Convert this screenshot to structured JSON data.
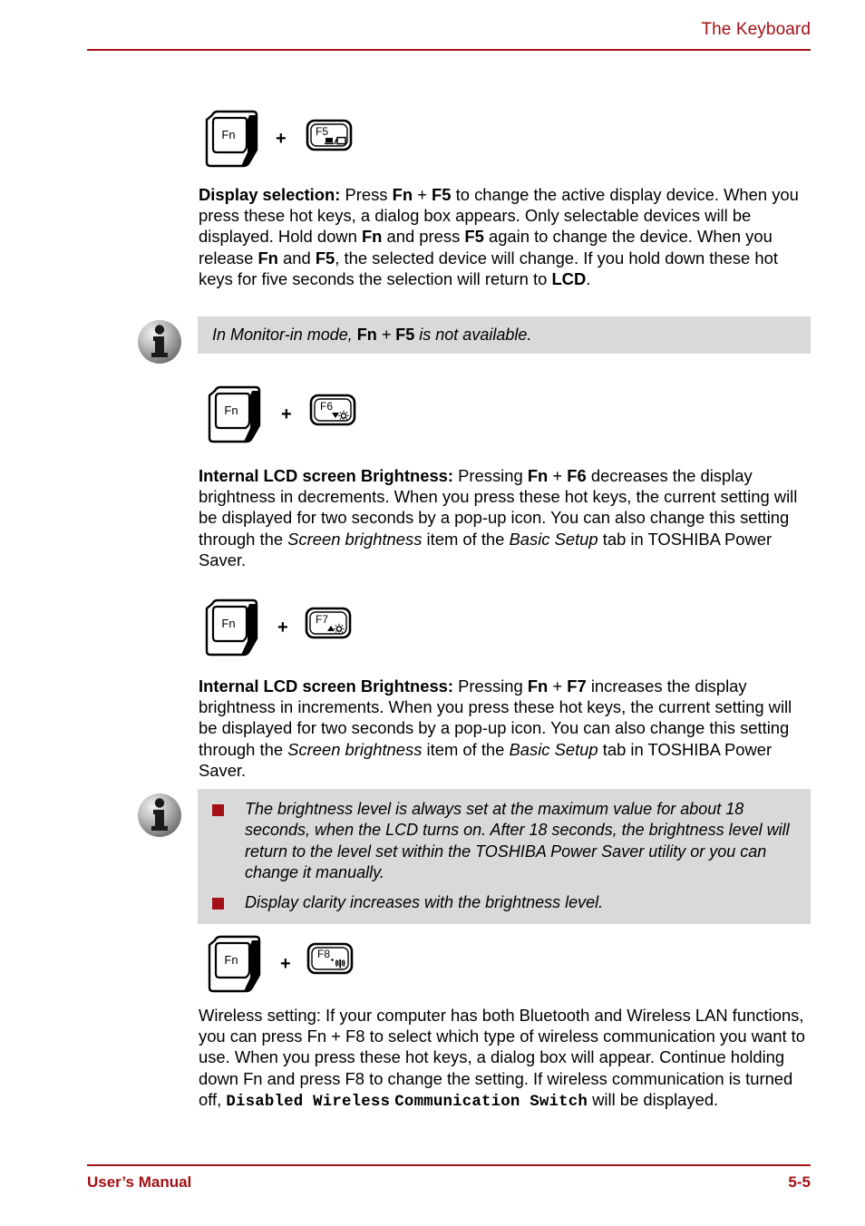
{
  "header": {
    "title": "The Keyboard"
  },
  "footer": {
    "left": "User’s Manual",
    "right": "5-5"
  },
  "symbols": {
    "plus": "+",
    "fn_label": "Fn"
  },
  "sections": [
    {
      "key_combo": {
        "modifier": "Fn",
        "function_key": "F5",
        "function_key_icon": "display-selection-icon"
      },
      "paragraph": {
        "lead": "Display selection:",
        "text": " Press Fn + F5 to change the active display device. When you press these hot keys, a dialog box appears. Only selectable devices will be displayed. Hold down Fn and press F5 again to change the device. When you release Fn and F5, the selected device will change. If you hold down these hot keys for five seconds the selection will return to LCD."
      },
      "note": {
        "icon": "info-icon",
        "text": "In Monitor-in mode, Fn + F5 is not available."
      }
    },
    {
      "key_combo": {
        "modifier": "Fn",
        "function_key": "F6",
        "function_key_icon": "brightness-down-icon"
      },
      "paragraph": {
        "lead": "Internal LCD screen Brightness:",
        "text": " Pressing Fn + F6 decreases the display brightness in decrements. When you press these hot keys, the current setting will be displayed for two seconds by a pop-up icon. You can also change this setting through the Screen brightness item of the Basic Setup tab in TOSHIBA Power Saver."
      }
    },
    {
      "key_combo": {
        "modifier": "Fn",
        "function_key": "F7",
        "function_key_icon": "brightness-up-icon"
      },
      "paragraph": {
        "lead": "Internal LCD screen Brightness:",
        "text": " Pressing Fn + F7 increases the display brightness in increments. When you press these hot keys, the current setting will be displayed for two seconds by a pop-up icon. You can also change this setting through the Screen brightness item of the Basic Setup tab in TOSHIBA Power Saver."
      },
      "note": {
        "icon": "info-icon",
        "bullets": [
          "The brightness level is always set at the maximum value for about 18 seconds, when the LCD turns on. After 18 seconds, the brightness level will return to the level set within the TOSHIBA Power Saver utility or you can change it manually.",
          "Display clarity increases with the brightness level."
        ]
      }
    },
    {
      "key_combo": {
        "modifier": "Fn",
        "function_key": "F8",
        "function_key_icon": "wireless-icon"
      },
      "paragraph": {
        "text_part1": "Wireless setting: If your computer has both Bluetooth and Wireless LAN functions, you can press Fn + F8 to select which type of wireless communication you want to use. When you press these hot keys, a dialog box will appear. Continue holding down Fn and press F8 to change the setting. If wireless communication is turned off, ",
        "code": "Disabled Wireless Communication Switch",
        "text_part2": " will be displayed."
      }
    }
  ],
  "text_runs": {
    "p1": [
      {
        "t": "Display selection:",
        "s": "b"
      },
      {
        "t": " Press ",
        "s": ""
      },
      {
        "t": "Fn",
        "s": "b"
      },
      {
        "t": " + ",
        "s": ""
      },
      {
        "t": "F5",
        "s": "b"
      },
      {
        "t": " to change the active display device. When you press these hot keys, a dialog box appears. Only selectable devices will be displayed. Hold down ",
        "s": ""
      },
      {
        "t": "Fn",
        "s": "b"
      },
      {
        "t": " and press ",
        "s": ""
      },
      {
        "t": "F5",
        "s": "b"
      },
      {
        "t": " again to change the device. When you release ",
        "s": ""
      },
      {
        "t": "Fn",
        "s": "b"
      },
      {
        "t": " and ",
        "s": ""
      },
      {
        "t": "F5",
        "s": "b"
      },
      {
        "t": ", the selected device will change. If you hold down these hot keys for five seconds the selection will return to ",
        "s": ""
      },
      {
        "t": "LCD",
        "s": "b"
      },
      {
        "t": ".",
        "s": ""
      }
    ],
    "note1": [
      {
        "t": "In Monitor-in mode, ",
        "s": "i"
      },
      {
        "t": "Fn",
        "s": "b"
      },
      {
        "t": " + ",
        "s": "i"
      },
      {
        "t": "F5",
        "s": "b"
      },
      {
        "t": " is not available.",
        "s": "i"
      }
    ],
    "p2": [
      {
        "t": "Internal LCD screen Brightness:",
        "s": "b"
      },
      {
        "t": " Pressing ",
        "s": ""
      },
      {
        "t": "Fn",
        "s": "b"
      },
      {
        "t": " + ",
        "s": ""
      },
      {
        "t": "F6",
        "s": "b"
      },
      {
        "t": " decreases the display brightness in decrements. When you press these hot keys, the current setting will be displayed for two seconds by a pop-up icon. You can also change this setting through the ",
        "s": ""
      },
      {
        "t": "Screen brightness",
        "s": "i"
      },
      {
        "t": " item of the ",
        "s": ""
      },
      {
        "t": "Basic Setup",
        "s": "i"
      },
      {
        "t": " tab in TOSHIBA Power Saver.",
        "s": ""
      }
    ],
    "p3": [
      {
        "t": "Internal LCD screen Brightness:",
        "s": "b"
      },
      {
        "t": " Pressing ",
        "s": ""
      },
      {
        "t": "Fn",
        "s": "b"
      },
      {
        "t": " + ",
        "s": ""
      },
      {
        "t": "F7",
        "s": "b"
      },
      {
        "t": " increases the display brightness in increments. When you press these hot keys, the current setting will be displayed for two seconds by a pop-up icon. You can also change this setting through the ",
        "s": ""
      },
      {
        "t": "Screen brightness",
        "s": "i"
      },
      {
        "t": " item of the ",
        "s": ""
      },
      {
        "t": "Basic Setup",
        "s": "i"
      },
      {
        "t": " tab in TOSHIBA Power Saver.",
        "s": ""
      }
    ],
    "note2a": [
      {
        "t": "The brightness level is always set at the maximum value for about 18 seconds, when the LCD turns on. After 18 seconds, the brightness level will return to the level set within the TOSHIBA Power Saver utility or you can change it manually.",
        "s": "i"
      }
    ],
    "note2b": [
      {
        "t": "Display clarity increases with the brightness level.",
        "s": "i"
      }
    ],
    "p4": [
      {
        "t": "Wireless setting: If your computer has both Bluetooth and Wireless LAN functions, you can press Fn + F8 to select which type of wireless communication you want to use. When you press these hot keys, a dialog box will appear. Continue holding down Fn and press F8 to change the setting. If wireless communication is turned off, ",
        "s": ""
      },
      {
        "t": "Disabled Wireless",
        "s": "m"
      },
      {
        "t": " ",
        "s": ""
      },
      {
        "t": "Communication Switch",
        "s": "m"
      },
      {
        "t": " will be displayed.",
        "s": ""
      }
    ]
  },
  "colors": {
    "accent_red": "#a31016",
    "note_background": "#d9d9d9",
    "bullet_red": "#a31016",
    "text": "#000000"
  }
}
